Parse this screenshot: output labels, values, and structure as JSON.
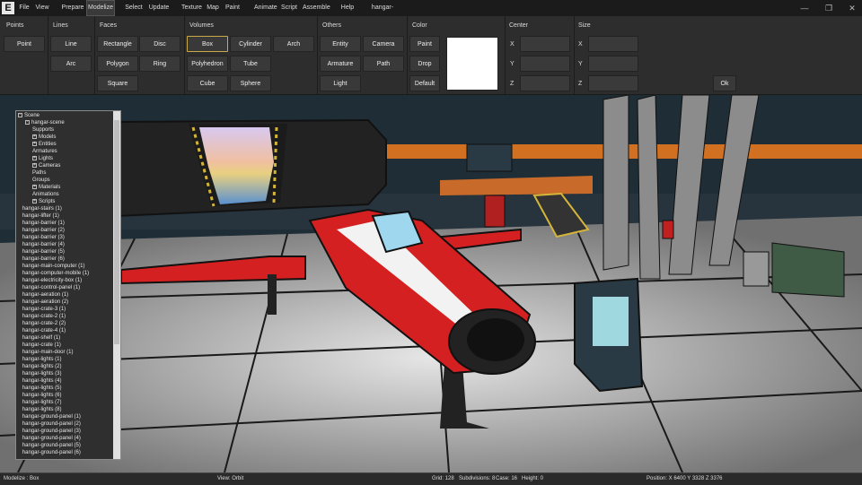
{
  "menubar": {
    "logo": "E",
    "items": [
      "File",
      "View",
      "Prepare",
      "Modelize",
      "Select",
      "Update",
      "Texture",
      "Map",
      "Paint",
      "Animate",
      "Script",
      "Assemble",
      "Help",
      "hangar-scene"
    ],
    "active": "Modelize",
    "window_controls": {
      "minimize": "—",
      "restore": "❐",
      "close": "✕"
    }
  },
  "toolbar": {
    "points": {
      "title": "Points",
      "buttons": [
        "Point"
      ]
    },
    "lines": {
      "title": "Lines",
      "buttons": [
        "Line",
        "Arc"
      ]
    },
    "faces": {
      "title": "Faces",
      "buttons": [
        "Rectangle",
        "Disc",
        "Polygon",
        "Ring",
        "Square"
      ]
    },
    "volumes": {
      "title": "Volumes",
      "buttons": [
        "Box",
        "Cylinder",
        "Arch",
        "Polyhedron",
        "Tube",
        "Cube",
        "Sphere"
      ],
      "selected": "Box"
    },
    "others": {
      "title": "Others",
      "buttons": [
        "Entity",
        "Camera",
        "Armature",
        "Path",
        "Light"
      ]
    },
    "color": {
      "title": "Color",
      "buttons": [
        "Paint",
        "Drop",
        "Default"
      ],
      "swatch": "#ffffff"
    },
    "center": {
      "title": "Center",
      "axes": [
        "X",
        "Y",
        "Z"
      ]
    },
    "size": {
      "title": "Size",
      "axes": [
        "X",
        "Y",
        "Z"
      ],
      "ok_label": "Ok"
    }
  },
  "scene_tree": {
    "root": "Scene",
    "scene_name": "hangar-scene",
    "categories": [
      "Supports",
      "Models",
      "Entities",
      "Armatures",
      "Lights",
      "Cameras",
      "Paths",
      "Groups",
      "Materials",
      "Animations",
      "Scripts"
    ],
    "objects": [
      "hangar-stairs (1)",
      "hangar-lifter (1)",
      "hangar-barrier (1)",
      "hangar-barrier (2)",
      "hangar-barrier (3)",
      "hangar-barrier (4)",
      "hangar-barrier (5)",
      "hangar-barrier (6)",
      "hangar-main-computer (1)",
      "hangar-computer-mobile (1)",
      "hangar-electricity-box (1)",
      "hangar-control-panel (1)",
      "hangar-aeration (1)",
      "hangar-aeration (2)",
      "hangar-crate-3 (1)",
      "hangar-crate-2 (1)",
      "hangar-crate-2 (2)",
      "hangar-crate-4 (1)",
      "hangar-shelf (1)",
      "hangar-crate (1)",
      "hangar-main-door (1)",
      "hangar-lights (1)",
      "hangar-lights (2)",
      "hangar-lights (3)",
      "hangar-lights (4)",
      "hangar-lights (5)",
      "hangar-lights (6)",
      "hangar-lights (7)",
      "hangar-lights (8)",
      "hangar-ground-panel (1)",
      "hangar-ground-panel (2)",
      "hangar-ground-panel (3)",
      "hangar-ground-panel (4)",
      "hangar-ground-panel (5)",
      "hangar-ground-panel (6)"
    ]
  },
  "statusbar": {
    "mode": "Modelize : Box",
    "view": "View: Orbit",
    "grid": "Grid: 128",
    "subdivisions": "Subdivisions: 8",
    "case": "Case: 16",
    "height": "Height: 0",
    "position": "Position: X 6400 Y 3328 Z 3376"
  }
}
